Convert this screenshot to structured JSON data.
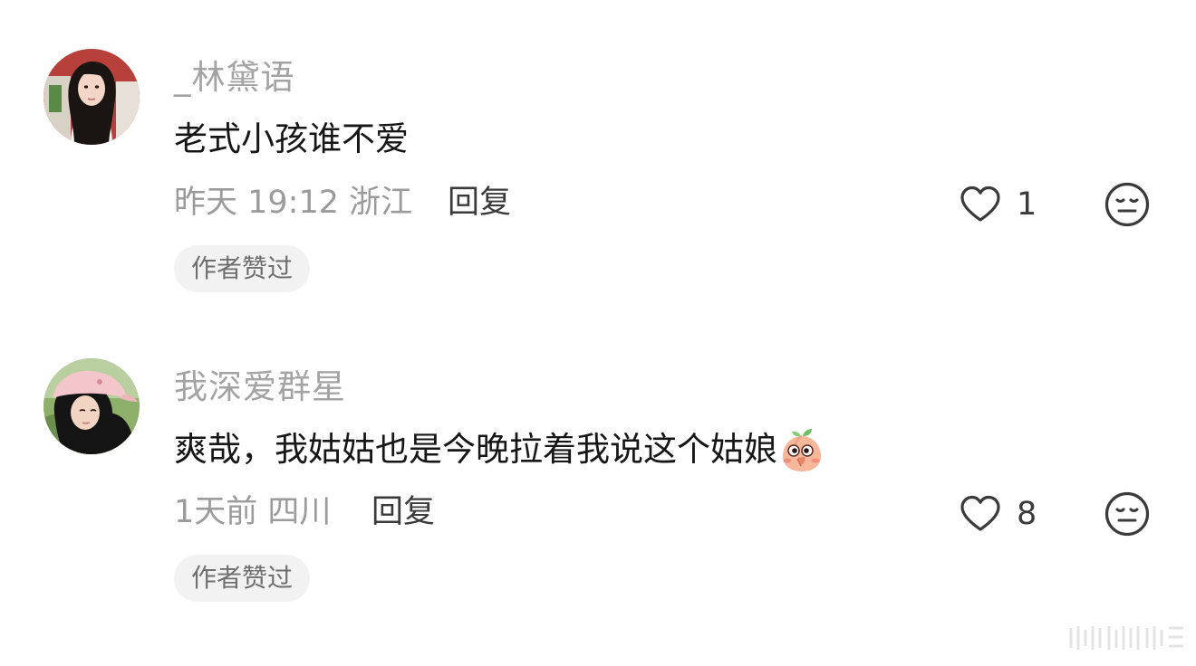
{
  "comments": [
    {
      "username": "_林黛语",
      "text": "老式小孩谁不爱",
      "meta": "昨天 19:12 浙江",
      "reply_label": "回复",
      "likes": "1",
      "badge": "作者赞过",
      "avatar_icon": "avatar-girl-dark-hair-icon"
    },
    {
      "username": "我深爱群星",
      "text": "爽哉，我姑姑也是今晚拉着我说这个姑娘",
      "meta": "1天前 四川",
      "reply_label": "回复",
      "likes": "8",
      "badge": "作者赞过",
      "avatar_icon": "avatar-girl-pink-cap-icon",
      "emoji_icon": "peach-blush-emoji-icon"
    }
  ],
  "colors": {
    "username": "#a3a3a3",
    "text": "#161616",
    "meta": "#9b9b9b",
    "action": "#3a3a3a",
    "badge_bg": "#f2f2f2"
  }
}
